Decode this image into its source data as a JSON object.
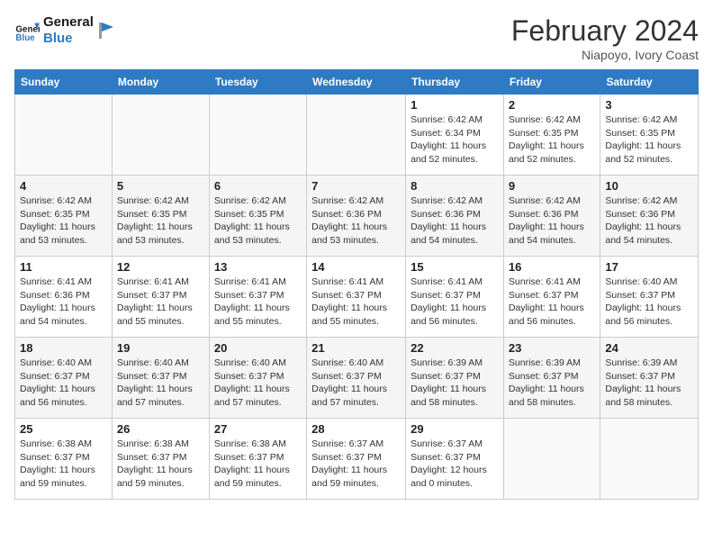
{
  "header": {
    "logo_line1": "General",
    "logo_line2": "Blue",
    "month_title": "February 2024",
    "location": "Niapoyo, Ivory Coast"
  },
  "days_of_week": [
    "Sunday",
    "Monday",
    "Tuesday",
    "Wednesday",
    "Thursday",
    "Friday",
    "Saturday"
  ],
  "weeks": [
    [
      {
        "day": "",
        "info": ""
      },
      {
        "day": "",
        "info": ""
      },
      {
        "day": "",
        "info": ""
      },
      {
        "day": "",
        "info": ""
      },
      {
        "day": "1",
        "info": "Sunrise: 6:42 AM\nSunset: 6:34 PM\nDaylight: 11 hours\nand 52 minutes."
      },
      {
        "day": "2",
        "info": "Sunrise: 6:42 AM\nSunset: 6:35 PM\nDaylight: 11 hours\nand 52 minutes."
      },
      {
        "day": "3",
        "info": "Sunrise: 6:42 AM\nSunset: 6:35 PM\nDaylight: 11 hours\nand 52 minutes."
      }
    ],
    [
      {
        "day": "4",
        "info": "Sunrise: 6:42 AM\nSunset: 6:35 PM\nDaylight: 11 hours\nand 53 minutes."
      },
      {
        "day": "5",
        "info": "Sunrise: 6:42 AM\nSunset: 6:35 PM\nDaylight: 11 hours\nand 53 minutes."
      },
      {
        "day": "6",
        "info": "Sunrise: 6:42 AM\nSunset: 6:35 PM\nDaylight: 11 hours\nand 53 minutes."
      },
      {
        "day": "7",
        "info": "Sunrise: 6:42 AM\nSunset: 6:36 PM\nDaylight: 11 hours\nand 53 minutes."
      },
      {
        "day": "8",
        "info": "Sunrise: 6:42 AM\nSunset: 6:36 PM\nDaylight: 11 hours\nand 54 minutes."
      },
      {
        "day": "9",
        "info": "Sunrise: 6:42 AM\nSunset: 6:36 PM\nDaylight: 11 hours\nand 54 minutes."
      },
      {
        "day": "10",
        "info": "Sunrise: 6:42 AM\nSunset: 6:36 PM\nDaylight: 11 hours\nand 54 minutes."
      }
    ],
    [
      {
        "day": "11",
        "info": "Sunrise: 6:41 AM\nSunset: 6:36 PM\nDaylight: 11 hours\nand 54 minutes."
      },
      {
        "day": "12",
        "info": "Sunrise: 6:41 AM\nSunset: 6:37 PM\nDaylight: 11 hours\nand 55 minutes."
      },
      {
        "day": "13",
        "info": "Sunrise: 6:41 AM\nSunset: 6:37 PM\nDaylight: 11 hours\nand 55 minutes."
      },
      {
        "day": "14",
        "info": "Sunrise: 6:41 AM\nSunset: 6:37 PM\nDaylight: 11 hours\nand 55 minutes."
      },
      {
        "day": "15",
        "info": "Sunrise: 6:41 AM\nSunset: 6:37 PM\nDaylight: 11 hours\nand 56 minutes."
      },
      {
        "day": "16",
        "info": "Sunrise: 6:41 AM\nSunset: 6:37 PM\nDaylight: 11 hours\nand 56 minutes."
      },
      {
        "day": "17",
        "info": "Sunrise: 6:40 AM\nSunset: 6:37 PM\nDaylight: 11 hours\nand 56 minutes."
      }
    ],
    [
      {
        "day": "18",
        "info": "Sunrise: 6:40 AM\nSunset: 6:37 PM\nDaylight: 11 hours\nand 56 minutes."
      },
      {
        "day": "19",
        "info": "Sunrise: 6:40 AM\nSunset: 6:37 PM\nDaylight: 11 hours\nand 57 minutes."
      },
      {
        "day": "20",
        "info": "Sunrise: 6:40 AM\nSunset: 6:37 PM\nDaylight: 11 hours\nand 57 minutes."
      },
      {
        "day": "21",
        "info": "Sunrise: 6:40 AM\nSunset: 6:37 PM\nDaylight: 11 hours\nand 57 minutes."
      },
      {
        "day": "22",
        "info": "Sunrise: 6:39 AM\nSunset: 6:37 PM\nDaylight: 11 hours\nand 58 minutes."
      },
      {
        "day": "23",
        "info": "Sunrise: 6:39 AM\nSunset: 6:37 PM\nDaylight: 11 hours\nand 58 minutes."
      },
      {
        "day": "24",
        "info": "Sunrise: 6:39 AM\nSunset: 6:37 PM\nDaylight: 11 hours\nand 58 minutes."
      }
    ],
    [
      {
        "day": "25",
        "info": "Sunrise: 6:38 AM\nSunset: 6:37 PM\nDaylight: 11 hours\nand 59 minutes."
      },
      {
        "day": "26",
        "info": "Sunrise: 6:38 AM\nSunset: 6:37 PM\nDaylight: 11 hours\nand 59 minutes."
      },
      {
        "day": "27",
        "info": "Sunrise: 6:38 AM\nSunset: 6:37 PM\nDaylight: 11 hours\nand 59 minutes."
      },
      {
        "day": "28",
        "info": "Sunrise: 6:37 AM\nSunset: 6:37 PM\nDaylight: 11 hours\nand 59 minutes."
      },
      {
        "day": "29",
        "info": "Sunrise: 6:37 AM\nSunset: 6:37 PM\nDaylight: 12 hours\nand 0 minutes."
      },
      {
        "day": "",
        "info": ""
      },
      {
        "day": "",
        "info": ""
      }
    ]
  ]
}
